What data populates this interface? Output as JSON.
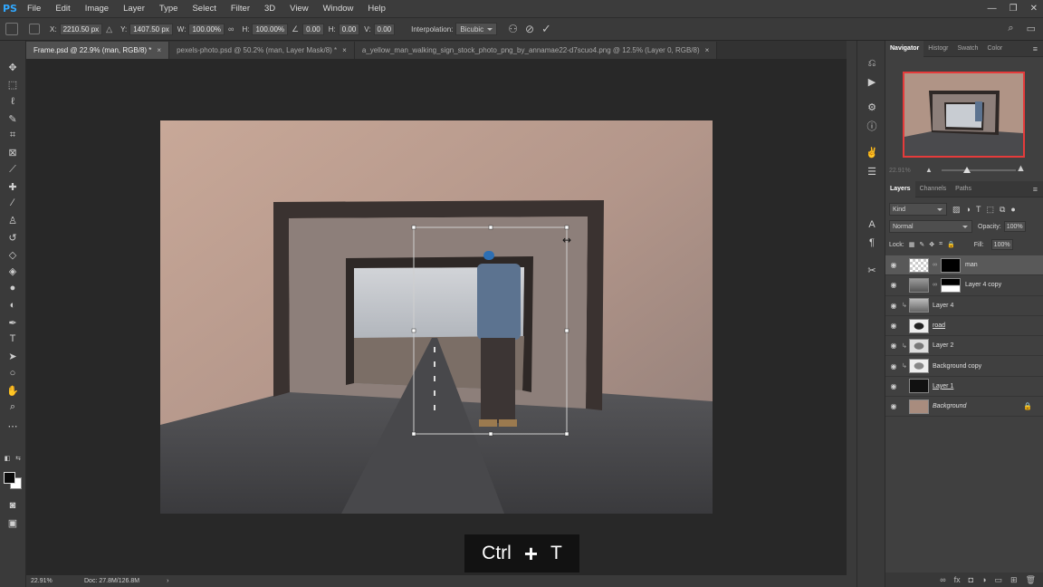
{
  "app": {
    "logo": "PS"
  },
  "menu": [
    "File",
    "Edit",
    "Image",
    "Layer",
    "Type",
    "Select",
    "Filter",
    "3D",
    "View",
    "Window",
    "Help"
  ],
  "window_controls": {
    "minimize": "—",
    "restore": "❐",
    "close": "✕"
  },
  "options": {
    "x_label": "X:",
    "x_value": "2210.50 px",
    "y_label": "Y:",
    "y_value": "1407.50 px",
    "w_label": "W:",
    "w_value": "100.00%",
    "h_label": "H:",
    "h_value": "100.00%",
    "angle_value": "0.00",
    "hskew_label": "H:",
    "hskew_value": "0.00",
    "vskew_label": "V:",
    "vskew_value": "0.00",
    "interp_label": "Interpolation:",
    "interp_value": "Bicubic"
  },
  "tabs": [
    {
      "label": "Frame.psd @ 22.9% (man, RGB/8) *",
      "close": "×"
    },
    {
      "label": "pexels-photo.psd @ 50.2% (man, Layer Mask/8) *",
      "close": "×"
    },
    {
      "label": "a_yellow_man_walking_sign_stock_photo_png_by_annamae22-d7scuo4.png @ 12.5% (Layer 0, RGB/8)",
      "close": "×"
    }
  ],
  "shortcut_overlay": {
    "key1": "Ctrl",
    "plus": "+",
    "key2": "T"
  },
  "status": {
    "zoom": "22.91%",
    "doc": "Doc: 27.8M/126.8M",
    "arrow": "›"
  },
  "navigator": {
    "tabs": [
      "Navigator",
      "Histogr",
      "Swatch",
      "Color"
    ],
    "zoom": "22.91%",
    "zoom_fraction": 0.35
  },
  "layers_panel": {
    "tabs": [
      "Layers",
      "Channels",
      "Paths"
    ],
    "kind": "Kind",
    "blend_mode": "Normal",
    "opacity_label": "Opacity:",
    "opacity_value": "100%",
    "lock_label": "Lock:",
    "fill_label": "Fill:",
    "fill_value": "100%",
    "layers": [
      {
        "name": "man",
        "selected": true,
        "mask": true
      },
      {
        "name": "Layer 4 copy",
        "selected": false,
        "mask": true
      },
      {
        "name": "Layer 4",
        "selected": false,
        "mask": false,
        "clipped": true
      },
      {
        "name": "road",
        "selected": false,
        "mask": false,
        "underline": true
      },
      {
        "name": "Layer 2",
        "selected": false,
        "mask": false,
        "clipped": true
      },
      {
        "name": "Background copy",
        "selected": false,
        "mask": false,
        "clipped": true
      },
      {
        "name": "Layer 1",
        "selected": false,
        "mask": false,
        "underline": true
      },
      {
        "name": "Background",
        "selected": false,
        "mask": false,
        "italic": true,
        "locked": true
      }
    ]
  }
}
